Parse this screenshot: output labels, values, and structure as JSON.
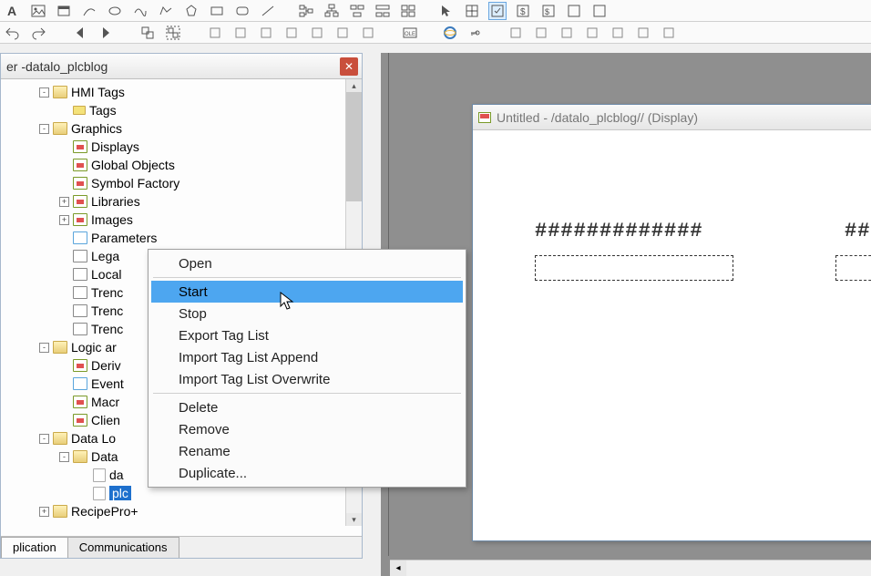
{
  "panel": {
    "title_prefix": "er - ",
    "title_project": "datalo_plcblog"
  },
  "tree": {
    "items": [
      {
        "label": "HMI Tags",
        "type": "folder",
        "depth": 1,
        "exp": "-"
      },
      {
        "label": "Tags",
        "type": "tag",
        "depth": 2,
        "exp": ""
      },
      {
        "label": "Graphics",
        "type": "folder",
        "depth": 1,
        "exp": "-"
      },
      {
        "label": "Displays",
        "type": "display",
        "depth": 2,
        "exp": ""
      },
      {
        "label": "Global Objects",
        "type": "display",
        "depth": 2,
        "exp": ""
      },
      {
        "label": "Symbol Factory",
        "type": "display",
        "depth": 2,
        "exp": ""
      },
      {
        "label": "Libraries",
        "type": "display",
        "depth": 2,
        "exp": "+"
      },
      {
        "label": "Images",
        "type": "display",
        "depth": 2,
        "exp": "+"
      },
      {
        "label": "Parameters",
        "type": "param",
        "depth": 2,
        "exp": ""
      },
      {
        "label": "Lega",
        "type": "trend",
        "depth": 2,
        "exp": ""
      },
      {
        "label": "Local",
        "type": "trend",
        "depth": 2,
        "exp": ""
      },
      {
        "label": "Trenc",
        "type": "trend",
        "depth": 2,
        "exp": ""
      },
      {
        "label": "Trenc",
        "type": "trend",
        "depth": 2,
        "exp": ""
      },
      {
        "label": "Trenc",
        "type": "trend",
        "depth": 2,
        "exp": ""
      },
      {
        "label": "Logic ar",
        "type": "folder",
        "depth": 1,
        "exp": "-"
      },
      {
        "label": "Deriv",
        "type": "display",
        "depth": 2,
        "exp": ""
      },
      {
        "label": "Event",
        "type": "param",
        "depth": 2,
        "exp": ""
      },
      {
        "label": "Macr",
        "type": "display",
        "depth": 2,
        "exp": ""
      },
      {
        "label": "Clien",
        "type": "display",
        "depth": 2,
        "exp": ""
      },
      {
        "label": "Data Lo",
        "type": "folder",
        "depth": 1,
        "exp": "-"
      },
      {
        "label": "Data",
        "type": "folder2",
        "depth": 2,
        "exp": "-"
      },
      {
        "label": "da",
        "type": "file",
        "depth": 3,
        "exp": ""
      },
      {
        "label": "plc",
        "type": "file",
        "depth": 3,
        "exp": "",
        "selected": true
      },
      {
        "label": "RecipePro+",
        "type": "folder",
        "depth": 1,
        "exp": "+"
      }
    ]
  },
  "tabs": {
    "active": "plication",
    "inactive": "Communications"
  },
  "context_menu": {
    "items": [
      {
        "label": "Open"
      },
      {
        "sep": true
      },
      {
        "label": "Start",
        "hovered": true
      },
      {
        "label": "Stop"
      },
      {
        "label": "Export Tag List"
      },
      {
        "label": "Import Tag List Append"
      },
      {
        "label": "Import Tag List Overwrite"
      },
      {
        "sep": true
      },
      {
        "label": "Delete"
      },
      {
        "label": "Remove"
      },
      {
        "label": "Rename"
      },
      {
        "label": "Duplicate..."
      }
    ]
  },
  "design_window": {
    "title": "Untitled - /datalo_plcblog// (Display)"
  },
  "placeholders": {
    "hash1": "#############",
    "hash2": "##"
  }
}
